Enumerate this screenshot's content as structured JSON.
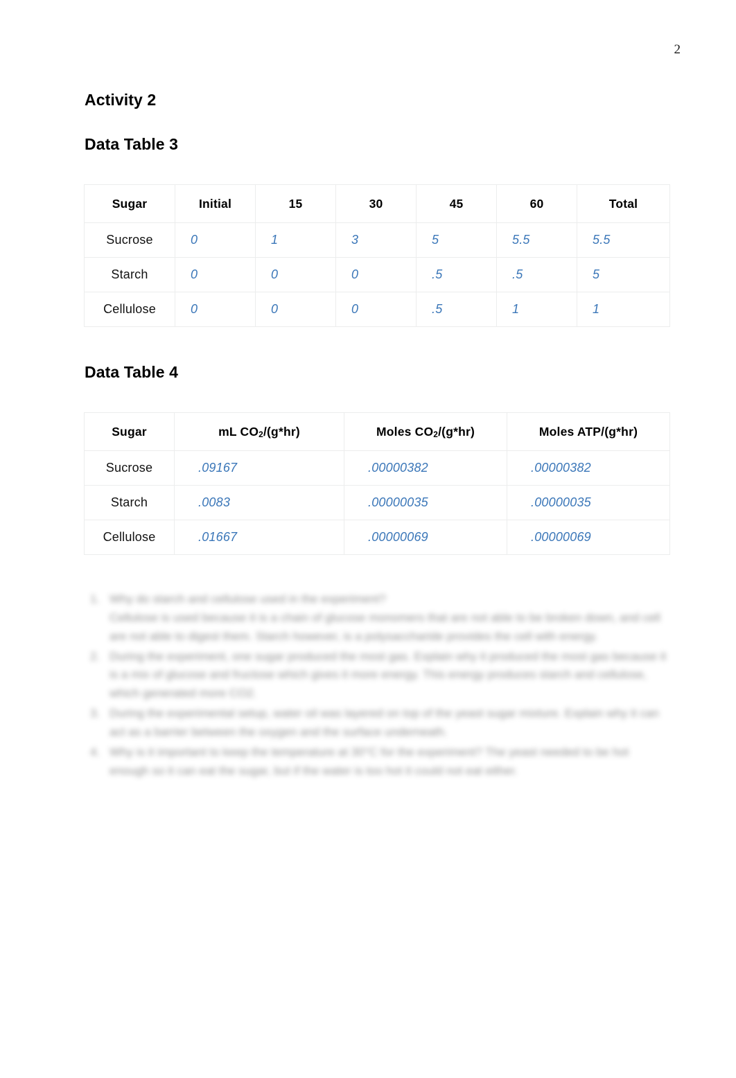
{
  "page": {
    "number": "2"
  },
  "headings": {
    "activity": "Activity 2",
    "table3": "Data Table 3",
    "table4": "Data Table 4"
  },
  "table3": {
    "columns": [
      "Sugar",
      "Initial",
      "15",
      "30",
      "45",
      "60",
      "Total"
    ],
    "rows": [
      {
        "label": "Sucrose",
        "initial": "0",
        "t15": "1",
        "t30": "3",
        "t45": "5",
        "t60": "5.5",
        "total": "5.5"
      },
      {
        "label": "Starch",
        "initial": "0",
        "t15": "0",
        "t30": "0",
        "t45": ".5",
        "t60": ".5",
        "total": "5"
      },
      {
        "label": "Cellulose",
        "initial": "0",
        "t15": "0",
        "t30": "0",
        "t45": ".5",
        "t60": "1",
        "total": "1"
      }
    ]
  },
  "table4": {
    "columns": {
      "sugar": "Sugar",
      "ml_co2_pre": "mL CO",
      "ml_co2_sub": "2",
      "ml_co2_post": "/(g*hr)",
      "moles_co2_pre": "Moles CO",
      "moles_co2_sub": "2",
      "moles_co2_post": "/(g*hr)",
      "moles_atp": "Moles ATP/(g*hr)"
    },
    "rows": [
      {
        "label": "Sucrose",
        "ml_co2": ".09167",
        "moles_co2": ".00000382",
        "moles_atp": ".00000382"
      },
      {
        "label": "Starch",
        "ml_co2": ".0083",
        "moles_co2": ".00000035",
        "moles_atp": ".00000035"
      },
      {
        "label": "Cellulose",
        "ml_co2": ".01667",
        "moles_co2": ".00000069",
        "moles_atp": ".00000069"
      }
    ]
  },
  "questions": [
    {
      "marker": "1.",
      "question": "Why do starch and cellulose used in the experiment?",
      "answer": "Cellulose is used because it is a chain of glucose monomers that are not able to be broken down, and cell are not able to digest them. Starch however, is a polysaccharide provides the cell with energy."
    },
    {
      "marker": "2.",
      "question": "During the experiment, one sugar produced the most gas. Explain why it produced the most gas because it is a mix of glucose and fructose which gives it more energy. This energy produces starch and cellulose, which generated more CO2."
    },
    {
      "marker": "3.",
      "question": "During the experimental setup, water oil was layered on top of the yeast sugar mixture. Explain why it can act as a barrier between the oxygen and the surface underneath."
    },
    {
      "marker": "4.",
      "question": "Why is it important to keep the temperature at 30°C for the experiment? The yeast needed to be hot enough so it can eat the sugar, but if the water is too hot it could not eat either."
    }
  ]
}
